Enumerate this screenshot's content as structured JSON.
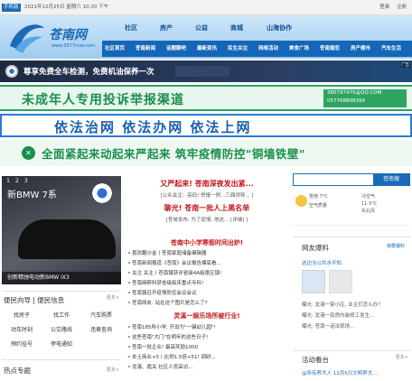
{
  "topbar": {
    "mobile": "手机版",
    "date": "2021年12月25日 星期六 10:20 下午",
    "links": [
      "登录",
      "注册"
    ]
  },
  "logo": {
    "name": "苍南网",
    "url": "www.0577cnw.com"
  },
  "nav": {
    "top": [
      "社区",
      "房产",
      "公益",
      "商城",
      "山海协作"
    ],
    "bottom": [
      "社区首页",
      "苍南新闻",
      "话题聊吧",
      "最新资讯",
      "民生关注",
      "网络活动",
      "美食广场",
      "苍南婚恋",
      "房产楼市",
      "汽车生活"
    ]
  },
  "ads": {
    "bmw": "尊享免费全车检测，免费机油保养一次",
    "minor": "未成年人专用投诉举报渠道",
    "minor_contact": [
      "380797475@QQ.COM",
      "057768898399"
    ],
    "law": "依法治网  依法办网  依法上网",
    "covid": "全面紧起来动起来严起来  筑牢疫情防控\"铜墙铁壁\"",
    "ad_label": "广告"
  },
  "slider": {
    "pages": [
      "1",
      "2",
      "3"
    ],
    "title": "新BMW 7系",
    "caption": "创新精驰电动新BMW iX3"
  },
  "convenience": {
    "title": "便民向导",
    "subtitle": "便民信息",
    "more": "更多>",
    "items": [
      "找房子",
      "找工作",
      "汽车购票",
      "动车时刻",
      "公交路线",
      "违章查询",
      "预约挂号",
      "停电通知"
    ]
  },
  "hot": {
    "title": "热点专题",
    "more": "更多>"
  },
  "center": {
    "headline1": "又严起来! 苍南深夜发出紧...",
    "sub1": "[公众关注：亮码! 举报一例...三酉领导... ]",
    "headline2": "聊光! 苍南一批人上黑名单",
    "sub2": "[苍坡发布: 为了疫情, 他这... [详细] ]",
    "headline3": "苍南中小学寒假时间出炉!",
    "list1": [
      "喜欢翻沙金丨苍南家庭储备编辑器",
      "苍南新闻报道《苍南》会议报告摸底看...",
      "关注 关注丨苍南镇获评省级4A级景区镇!",
      "苍南麻醉科获省级临床重点专科!",
      "苍南镇召开疫情防控会议会议",
      "苍南网友: 站在这个图片是怎么了?"
    ],
    "headline4": "灵溪一娱乐场所被行业!",
    "list2": [
      "苍南185所小学, 开设为\"一键幼儿园\"!",
      "这些苍南\"大门\"在明年的这些日子!",
      "苍南一批企业! 最高奖励1000",
      "本土商业+5丨比例1.5倍+51! 调研...",
      "龙港、霞关 社区人员采访..."
    ]
  },
  "right": {
    "search_btn": "苍南搜",
    "weather": {
      "loc": "苍南",
      "temp": "7°C",
      "air": "空气质量",
      "detail": [
        "冷空气",
        "11-3°C",
        "东北风"
      ]
    },
    "net": {
      "title": "网友爆料",
      "report": "我要爆料",
      "first": "这边当公共水不知",
      "replies": [
        "曝光: 龙港一家小区, 业主们怎么办？",
        "曝光: 龙港一民房内装修工发生...",
        "曝光: 苍南一话法现场..."
      ]
    },
    "activity": {
      "title": "活动看台",
      "more": "更多>",
      "item": "@所有养犬人 12月5日文明养犬..."
    }
  },
  "colors": {
    "brand": "#1a6bb5",
    "green": "#1a8f4d",
    "red": "#c4161c"
  }
}
